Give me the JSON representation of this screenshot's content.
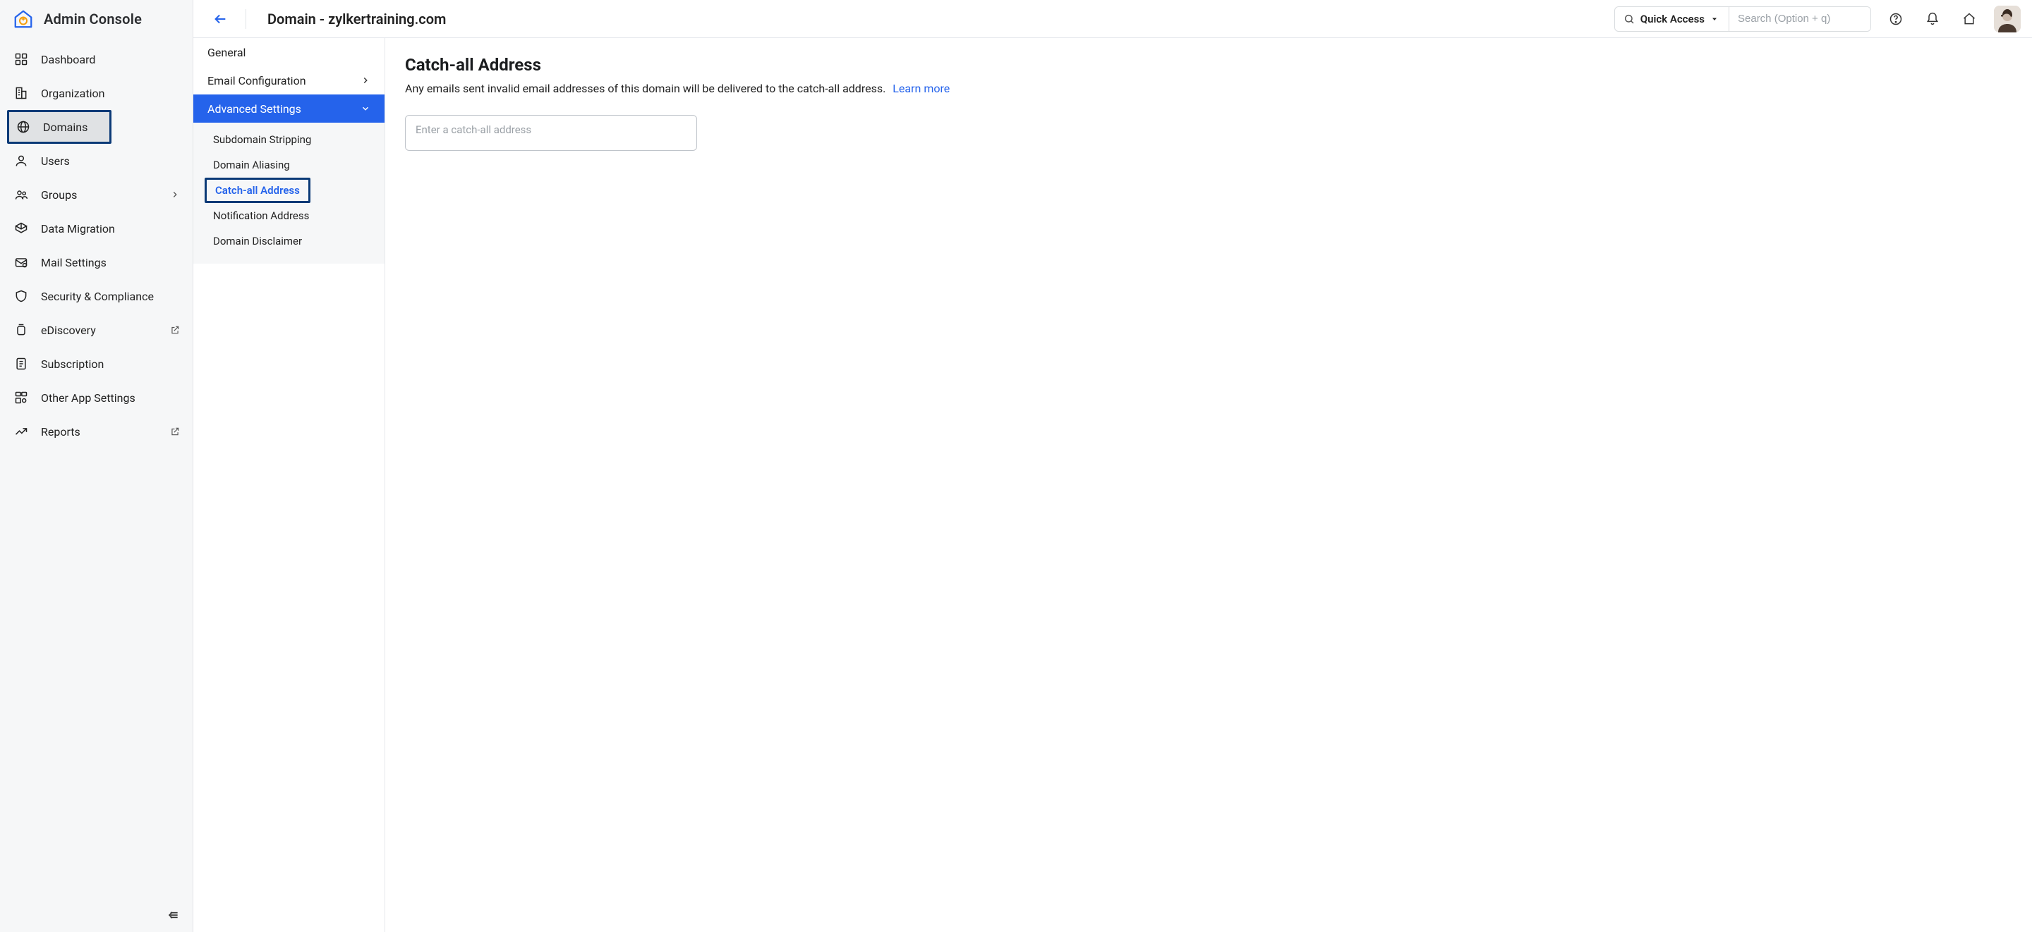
{
  "brand": {
    "title": "Admin Console"
  },
  "sidebar": {
    "items": [
      {
        "label": "Dashboard",
        "icon": "dashboard-icon"
      },
      {
        "label": "Organization",
        "icon": "building-icon"
      },
      {
        "label": "Domains",
        "icon": "globe-icon",
        "selected": true
      },
      {
        "label": "Users",
        "icon": "user-icon"
      },
      {
        "label": "Groups",
        "icon": "group-icon",
        "has_submenu": true
      },
      {
        "label": "Data Migration",
        "icon": "migration-icon"
      },
      {
        "label": "Mail Settings",
        "icon": "mail-settings-icon"
      },
      {
        "label": "Security & Compliance",
        "icon": "shield-icon"
      },
      {
        "label": "eDiscovery",
        "icon": "jar-icon",
        "external": true
      },
      {
        "label": "Subscription",
        "icon": "receipt-icon"
      },
      {
        "label": "Other App Settings",
        "icon": "apps-icon"
      },
      {
        "label": "Reports",
        "icon": "chart-icon",
        "external": true
      }
    ]
  },
  "header": {
    "page_title": "Domain - zylkertraining.com",
    "quick_access_label": "Quick Access",
    "search_placeholder": "Search (Option + q)"
  },
  "settings_sidebar": {
    "items": [
      {
        "label": "General"
      },
      {
        "label": "Email Configuration",
        "has_submenu": true
      },
      {
        "label": "Advanced Settings",
        "active": true,
        "children": [
          {
            "label": "Subdomain Stripping"
          },
          {
            "label": "Domain Aliasing"
          },
          {
            "label": "Catch-all Address",
            "current": true
          },
          {
            "label": "Notification Address"
          },
          {
            "label": "Domain Disclaimer"
          }
        ]
      }
    ]
  },
  "main": {
    "title": "Catch-all Address",
    "description": "Any emails sent invalid email addresses of this domain will be delivered to the catch-all address.",
    "learn_more": "Learn more",
    "input_placeholder": "Enter a catch-all address"
  }
}
